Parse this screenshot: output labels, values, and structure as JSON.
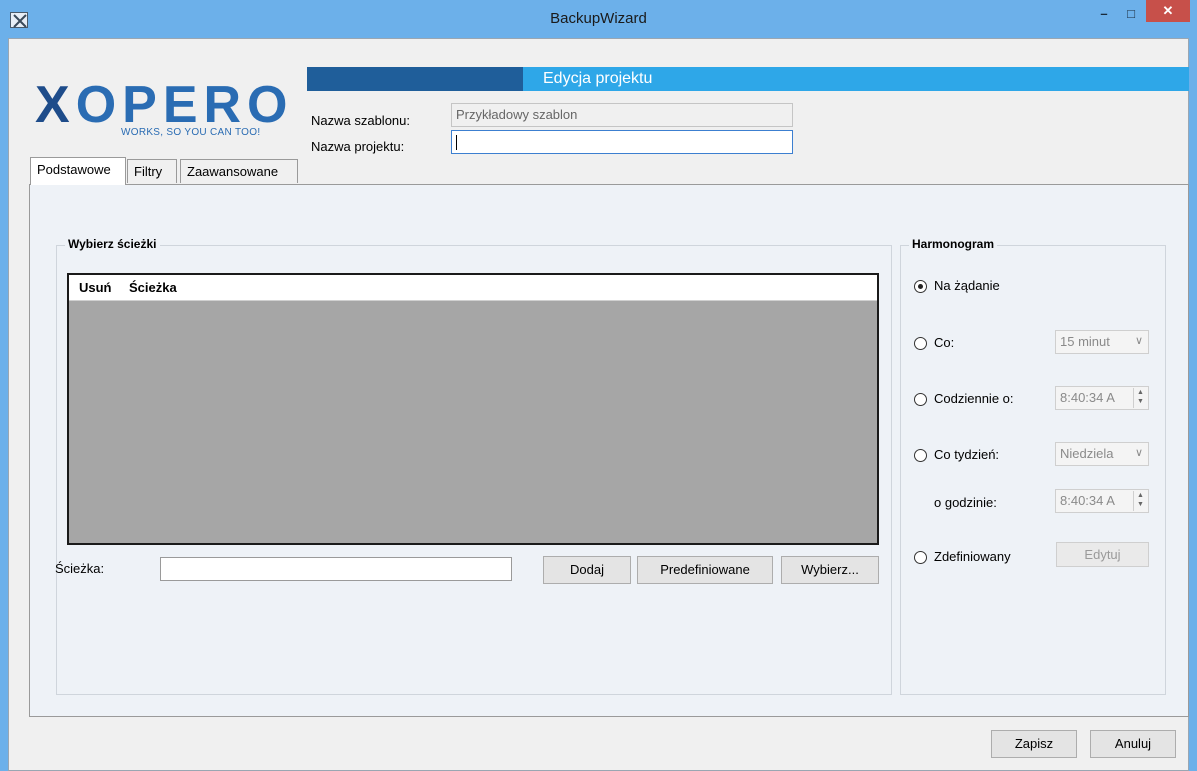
{
  "window": {
    "title": "BackupWizard",
    "minimize_glyph": "–",
    "maximize_glyph": "□",
    "close_glyph": "✕"
  },
  "logo": {
    "text": "OPERO",
    "x_letter": "X",
    "tagline": "WORKS, SO YOU CAN TOO!"
  },
  "header": {
    "title": "Edycja projektu"
  },
  "form": {
    "template_label": "Nazwa szablonu:",
    "template_value": "Przykładowy szablon",
    "project_label": "Nazwa projektu:",
    "project_value": ""
  },
  "tabs": [
    {
      "label": "Podstawowe",
      "active": true
    },
    {
      "label": "Filtry",
      "active": false
    },
    {
      "label": "Zaawansowane",
      "active": false
    }
  ],
  "paths_group": {
    "title": "Wybierz ścieżki",
    "columns": [
      "Usuń",
      "Ścieżka"
    ],
    "rows": [],
    "path_label": "Ścieżka:",
    "path_value": "",
    "add_button": "Dodaj",
    "predefined_button": "Predefiniowane",
    "choose_button": "Wybierz..."
  },
  "schedule_group": {
    "title": "Harmonogram",
    "on_demand_label": "Na żądanie",
    "every_label": "Co:",
    "every_value": "15 minut",
    "daily_label": "Codziennie o:",
    "daily_time": "8:40:34 A",
    "weekly_label": "Co tydzień:",
    "weekly_day": "Niedziela",
    "weekly_at_label": "o godzinie:",
    "weekly_time": "8:40:34 A",
    "custom_label": "Zdefiniowany",
    "edit_button": "Edytuj",
    "selected": "on_demand"
  },
  "footer": {
    "save_button": "Zapisz",
    "cancel_button": "Anuluj"
  },
  "colors": {
    "titlebar": "#6cb0ea",
    "header_light": "#2ea7e8",
    "header_dark": "#1f5e9a",
    "close_button": "#c7504a",
    "logo_blue": "#2a6cb3"
  }
}
